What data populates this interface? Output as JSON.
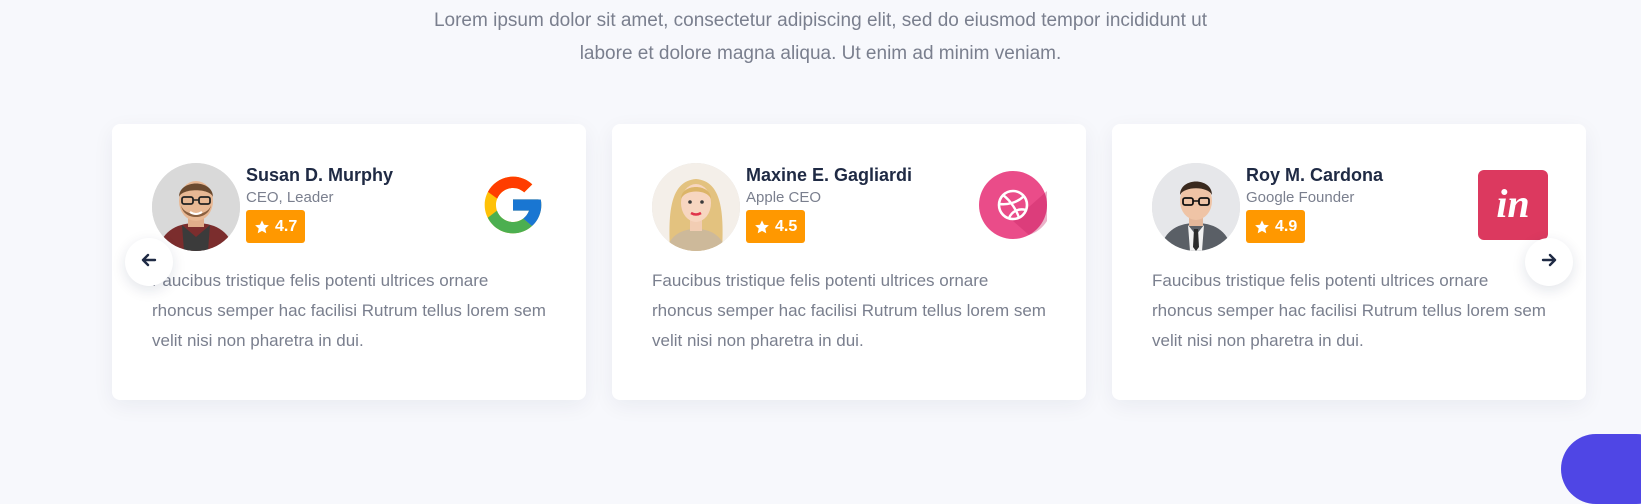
{
  "intro": {
    "line1": "Lorem ipsum dolor sit amet, consectetur adipiscing elit, sed do eiusmod tempor incididunt ut",
    "line2": "labore et dolore magna aliqua. Ut enim ad minim veniam."
  },
  "testimonials": [
    {
      "name": "Susan D. Murphy",
      "role": "CEO, Leader",
      "rating": "4.7",
      "brand_icon": "google-logo-icon",
      "avatar_icon": "avatar-man-glasses",
      "quote": "Faucibus tristique felis potenti ultrices ornare rhoncus semper hac facilisi Rutrum tellus lorem sem velit nisi non pharetra in dui."
    },
    {
      "name": "Maxine E. Gagliardi",
      "role": "Apple CEO",
      "rating": "4.5",
      "brand_icon": "dribbble-logo-icon",
      "avatar_icon": "avatar-woman-blonde",
      "quote": "Faucibus tristique felis potenti ultrices ornare rhoncus semper hac facilisi Rutrum tellus lorem sem velit nisi non pharetra in dui."
    },
    {
      "name": "Roy M. Cardona",
      "role": "Google Founder",
      "rating": "4.9",
      "brand_icon": "invision-logo-icon",
      "avatar_icon": "avatar-man-suit",
      "quote": "Faucibus tristique felis potenti ultrices ornare rhoncus semper hac facilisi Rutrum tellus lorem sem velit nisi non pharetra in dui."
    }
  ],
  "controls": {
    "prev_icon": "arrow-left-icon",
    "next_icon": "arrow-right-icon"
  },
  "colors": {
    "background": "#f7f8fc",
    "card": "#ffffff",
    "rating_badge": "#ff9800",
    "name_text": "#1f2a44",
    "body_text": "#7a7f8e",
    "dribbble": "#ea4c89",
    "invision": "#dc395f",
    "fab": "#4f46e5"
  }
}
